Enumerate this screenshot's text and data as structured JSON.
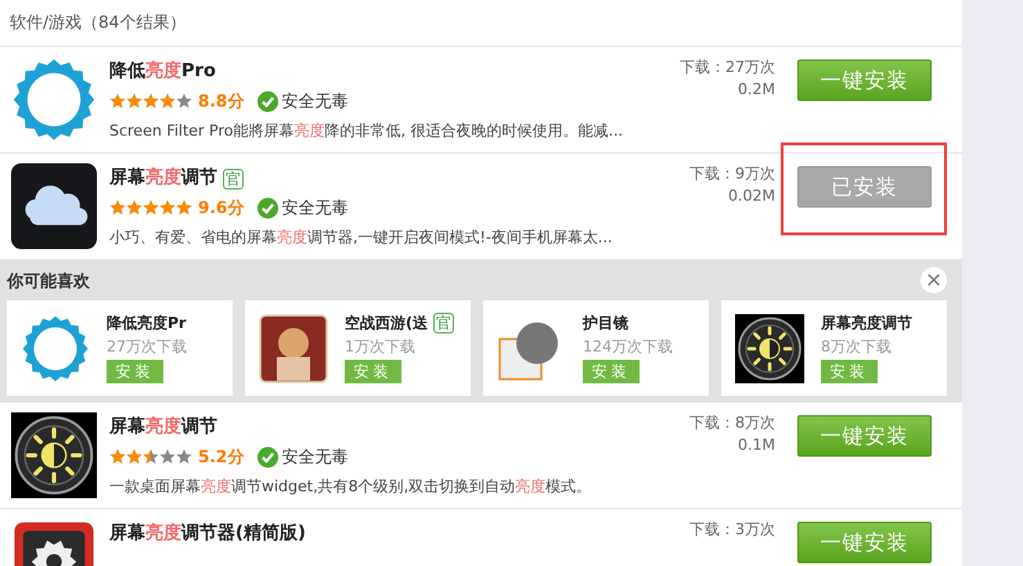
{
  "header": {
    "title": "软件/游戏（84个结果）"
  },
  "apps": [
    {
      "kind": "ring",
      "title": [
        {
          "text": "降低",
          "highlighted": false
        },
        {
          "text": "亮度",
          "highlighted": true
        },
        {
          "text": "Pro",
          "highlighted": false
        }
      ],
      "stars": 4,
      "score": "8.8分",
      "safety": "安全无毒",
      "description": [
        {
          "text": "Screen Filter Pro能將屏幕",
          "highlighted": false
        },
        {
          "text": "亮度",
          "highlighted": true
        },
        {
          "text": "降的非常低, 很适合夜晚的时候使用。能减...",
          "highlighted": false
        }
      ],
      "downloads": "下载：27万次",
      "size": "0.2M",
      "button": {
        "label": "一键安装",
        "installed": false
      },
      "annotated": false
    },
    {
      "kind": "cloud",
      "title": [
        {
          "text": "屏幕",
          "highlighted": false
        },
        {
          "text": "亮度",
          "highlighted": true
        },
        {
          "text": "调节",
          "highlighted": false
        }
      ],
      "badge": "官",
      "stars": 5,
      "score": "9.6分",
      "safety": "安全无毒",
      "description": [
        {
          "text": "小巧、有爱、省电的屏幕",
          "highlighted": false
        },
        {
          "text": "亮度",
          "highlighted": true
        },
        {
          "text": "调节器,一键开启夜间模式!-夜间手机屏幕太...",
          "highlighted": false
        }
      ],
      "downloads": "下载：9万次",
      "size": "0.02M",
      "button": {
        "label": "已安装",
        "installed": true
      },
      "annotated": true
    }
  ],
  "recommendations": {
    "title": "你可能喜欢",
    "close": "×",
    "items": [
      {
        "kind": "ring",
        "title": "降低亮度Pr",
        "downloads": "27万次下载",
        "button": "安装"
      },
      {
        "kind": "photo",
        "title": "空战西游(送",
        "badge": "官",
        "downloads": "1万次下载",
        "button": "安装"
      },
      {
        "kind": "circle-square",
        "title": "护目镜",
        "downloads": "124万次下载",
        "button": "安装"
      },
      {
        "kind": "sun",
        "title": "屏幕亮度调节",
        "downloads": "8万次下载",
        "button": "安装"
      }
    ]
  },
  "more_apps": [
    {
      "kind": "sun",
      "title": [
        {
          "text": "屏幕",
          "highlighted": false
        },
        {
          "text": "亮度",
          "highlighted": true
        },
        {
          "text": "调节",
          "highlighted": false
        }
      ],
      "stars": 2.5,
      "score": "5.2分",
      "safety": "安全无毒",
      "description": [
        {
          "text": "一款桌面屏幕",
          "highlighted": false
        },
        {
          "text": "亮度",
          "highlighted": true
        },
        {
          "text": "调节widget,共有8个级别,双击切换到自动",
          "highlighted": false
        },
        {
          "text": "亮度",
          "highlighted": true
        },
        {
          "text": "模式。",
          "highlighted": false
        }
      ],
      "downloads": "下载：8万次",
      "size": "0.1M",
      "button": {
        "label": "一键安装",
        "installed": false
      },
      "annotated": false
    },
    {
      "kind": "gear",
      "title": [
        {
          "text": "屏幕",
          "highlighted": false
        },
        {
          "text": "亮度",
          "highlighted": true
        },
        {
          "text": "调节器(精简版)",
          "highlighted": false
        }
      ],
      "downloads": "下载：3万次",
      "button": {
        "label": "一键安装",
        "installed": false
      },
      "annotated": false
    }
  ]
}
